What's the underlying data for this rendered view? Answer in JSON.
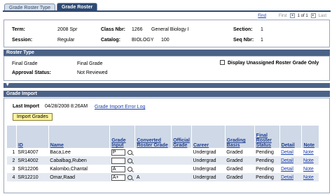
{
  "tabs": [
    {
      "label": "Grade Roster Type",
      "active": false
    },
    {
      "label": "Grade Roster",
      "active": true
    }
  ],
  "nav": {
    "find": "Find",
    "first": "First",
    "count": "1 of 1",
    "last": "Last"
  },
  "info": {
    "term_label": "Term:",
    "term_value": "2008 Spr",
    "class_nbr_label": "Class Nbr:",
    "class_nbr_value": "1266",
    "class_name": "General Biology I",
    "section_label": "Section:",
    "section_value": "1",
    "session_label": "Session:",
    "session_value": "Regular",
    "catalog_label": "Catalog:",
    "catalog_subject": "BIOLOGY",
    "catalog_number": "100",
    "seq_label": "Seq Nbr:",
    "seq_value": "1"
  },
  "roster_type": {
    "header": "Roster Type",
    "grade_label": "Final Grade",
    "grade_value": "Final Grade",
    "status_label": "Approval Status:",
    "status_value": "Not Reviewed",
    "checkbox_label": "Display Unassigned Roster Grade Only"
  },
  "grade_import": {
    "header": "Grade Import",
    "last_import_label": "Last Import",
    "last_import_value": "04/28/2008  8:26AM",
    "error_log_link": "Grade Import Error Log",
    "import_button": "Import Grades"
  },
  "table": {
    "headers": [
      "ID",
      "Name",
      "Grade Input",
      "Converted Roster Grade",
      "Official Grade",
      "Career",
      "Grading Basis",
      "Final Roster Status",
      "Detail",
      "Note"
    ],
    "rows": [
      {
        "num": "1",
        "id": "SR14007",
        "name": "Baca,Lee",
        "grade": "P",
        "converted": "",
        "official": "",
        "career": "Undergrad",
        "basis": "Graded",
        "status": "Pending",
        "detail": "Detail",
        "note": "Note"
      },
      {
        "num": "2",
        "id": "SR14002",
        "name": "Cabalbag,Ruben",
        "grade": "",
        "converted": "",
        "official": "",
        "career": "Undergrad",
        "basis": "Graded",
        "status": "Pending",
        "detail": "Detail",
        "note": "Note"
      },
      {
        "num": "3",
        "id": "SR12206",
        "name": "Kalombo,Chantal",
        "grade": "A",
        "converted": "",
        "official": "",
        "career": "Undergrad",
        "basis": "Graded",
        "status": "Pending",
        "detail": "Detail",
        "note": "Note"
      },
      {
        "num": "4",
        "id": "SR12210",
        "name": "Omar,Raad",
        "grade": "A+",
        "converted": "A",
        "official": "",
        "career": "Undergrad",
        "basis": "Graded",
        "status": "Pending",
        "detail": "Detail",
        "note": "Note"
      }
    ]
  }
}
